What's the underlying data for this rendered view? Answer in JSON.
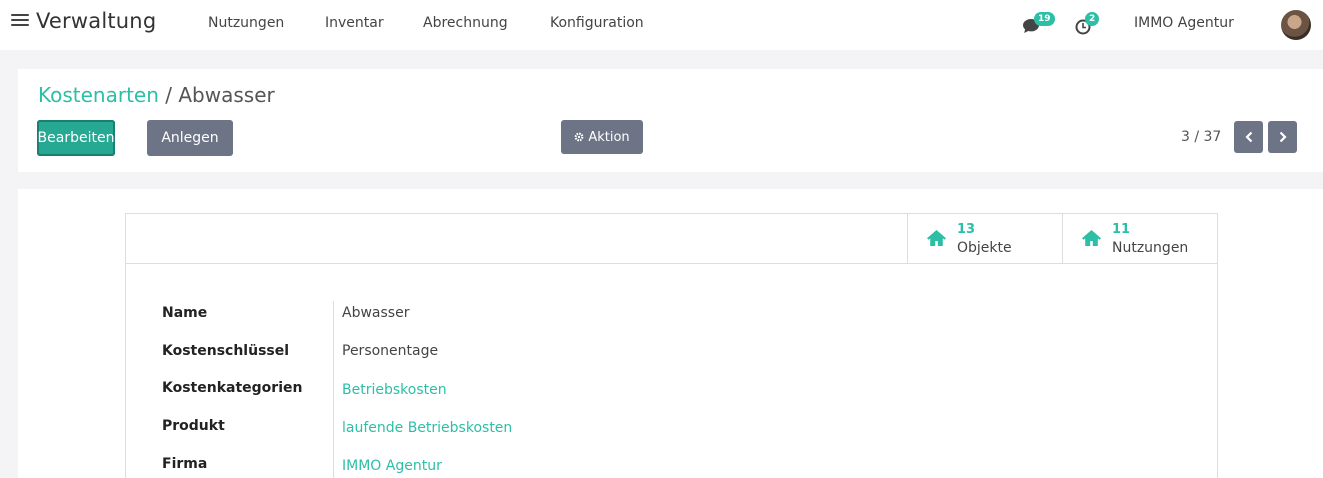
{
  "app": {
    "title": "Verwaltung"
  },
  "nav": [
    {
      "label": "Nutzungen"
    },
    {
      "label": "Inventar"
    },
    {
      "label": "Abrechnung"
    },
    {
      "label": "Konfiguration"
    }
  ],
  "systray": {
    "messages_count": "19",
    "activities_count": "2",
    "user_name": "IMMO Agentur"
  },
  "breadcrumb": {
    "parent": "Kostenarten",
    "separator": " / ",
    "current": "Abwasser"
  },
  "toolbar": {
    "edit_label": "Bearbeiten",
    "create_label": "Anlegen",
    "action_label": "Aktion"
  },
  "pager": {
    "value": "3 / 37"
  },
  "stats": [
    {
      "count": "13",
      "label": "Objekte"
    },
    {
      "count": "11",
      "label": "Nutzungen"
    }
  ],
  "fields": [
    {
      "label": "Name",
      "value": "Abwasser"
    },
    {
      "label": "Kostenschlüssel",
      "value": "Personentage"
    },
    {
      "label": "Kostenkategorien",
      "value": "Betriebskosten"
    },
    {
      "label": "Produkt",
      "value": "laufende Betriebskosten"
    },
    {
      "label": "Firma",
      "value": "IMMO Agentur"
    }
  ],
  "colors": {
    "accent": "#2cbfa6",
    "primary_button": "#26a893",
    "secondary_button": "#6c7485"
  }
}
